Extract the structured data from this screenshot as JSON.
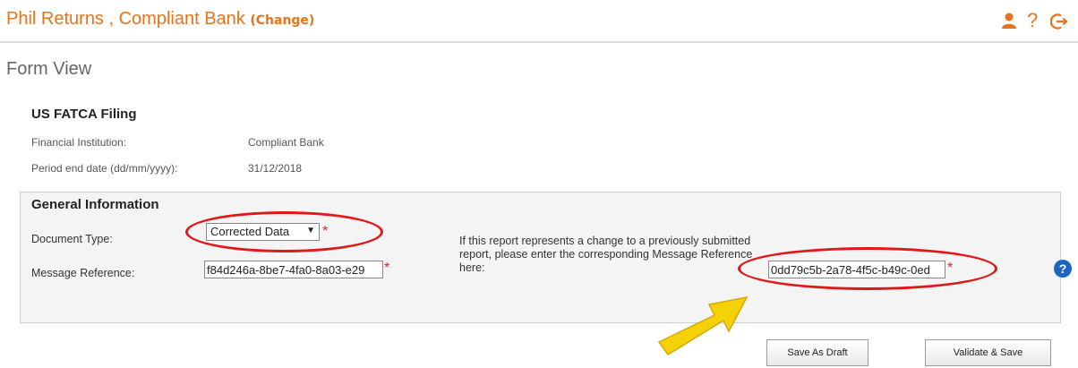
{
  "header": {
    "title": "Phil Returns , Compliant Bank ",
    "change_open": "(",
    "change_label": "Change",
    "change_close": ")",
    "icons": [
      "user-icon",
      "help-icon",
      "logout-icon"
    ],
    "help_glyph": "?"
  },
  "page": {
    "title": "Form View"
  },
  "filing": {
    "title": "US FATCA Filing",
    "fi_label": "Financial Institution:",
    "fi_value": "Compliant Bank",
    "period_label": "Period end date (dd/mm/yyyy):",
    "period_value": "31/12/2018"
  },
  "general": {
    "title": "General Information",
    "doc_type_label": "Document Type:",
    "doc_type_value": "Corrected Data",
    "doc_type_caret": "▼",
    "msg_ref_label": "Message Reference:",
    "msg_ref_value": "f84d246a-8be7-4fa0-8a03-e29",
    "required_mark": "*",
    "corr_note": "If this report represents a change to a previously submitted report, please enter the corresponding Message Reference here:",
    "corr_msg_ref_value": "0dd79c5b-2a78-4f5c-b49c-0ed",
    "help_glyph": "?"
  },
  "buttons": {
    "save_draft": "Save As Draft",
    "validate_save": "Validate & Save"
  },
  "colors": {
    "accent": "#e8731a",
    "annotation": "#e01818",
    "arrow": "#f5d10a",
    "help": "#1a65c4"
  }
}
